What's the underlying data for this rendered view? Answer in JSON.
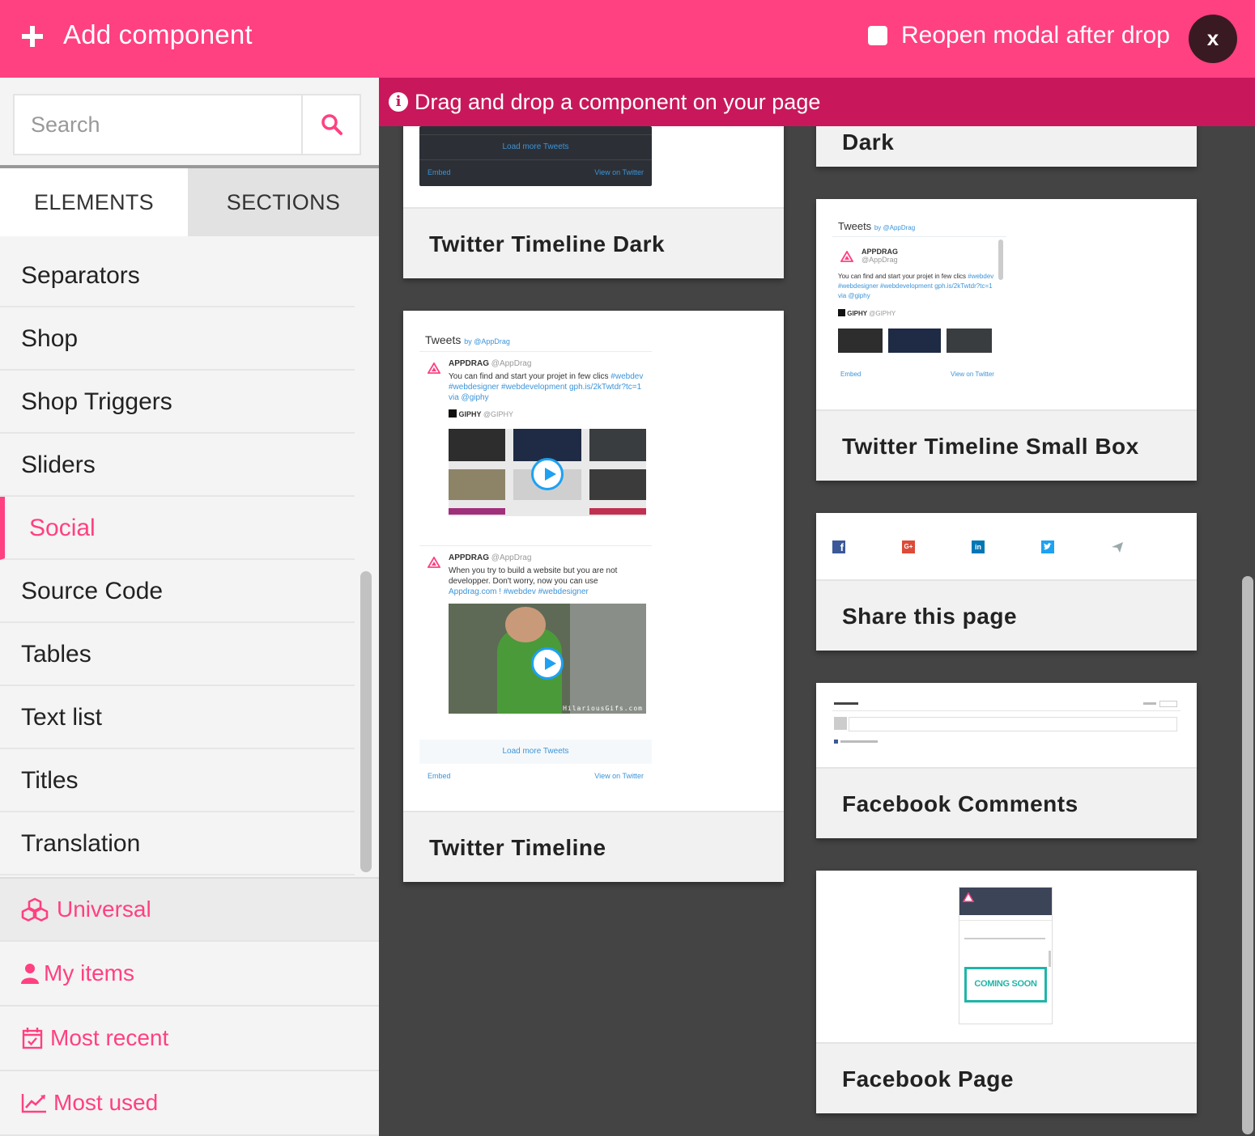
{
  "header": {
    "title": "Add component",
    "reopen_label": "Reopen modal after drop",
    "close_label": "x"
  },
  "search": {
    "placeholder": "Search"
  },
  "tabs": {
    "elements": "ELEMENTS",
    "sections": "SECTIONS"
  },
  "categories": [
    {
      "label": "Separators"
    },
    {
      "label": "Shop"
    },
    {
      "label": "Shop Triggers"
    },
    {
      "label": "Sliders"
    },
    {
      "label": "Social"
    },
    {
      "label": "Source Code"
    },
    {
      "label": "Tables"
    },
    {
      "label": "Text list"
    },
    {
      "label": "Titles"
    },
    {
      "label": "Translation"
    }
  ],
  "active_category": "Social",
  "bottom_nav": {
    "universal": "Universal",
    "my_items": "My items",
    "most_recent": "Most recent",
    "most_used": "Most used"
  },
  "banner": {
    "text": "Drag and drop a component on your page"
  },
  "cards": {
    "twitter_dark": "Twitter Timeline Dark",
    "dark_partial": "Dark",
    "twitter_timeline": "Twitter Timeline",
    "twitter_small": "Twitter Timeline Small Box",
    "share": "Share this page",
    "fb_comments": "Facebook Comments",
    "fb_page": "Facebook Page"
  },
  "preview": {
    "load_more": "Load more Tweets",
    "embed": "Embed",
    "view_on_twitter": "View on Twitter",
    "tweets": "Tweets",
    "by_handle": "by @AppDrag",
    "appdrag": "APPDRAG",
    "appdrag_handle": "@AppDrag",
    "tweet1": "You can find and start your projet in few clics",
    "tweet1_tags": "#webdev #webdesigner #webdevelopment gph.is/2kTwtdr?tc=1",
    "via": "via @giphy",
    "giphy": "GIPHY",
    "giphy_handle": "@GIPHY",
    "tweet2": "When you try to build a website but you are not developper. Don't worry, now you can use",
    "tweet2_tags": "Appdrag.com ! #webdev #webdesigner",
    "watermark": "HilariousGifs.com",
    "coming_soon": "COMING SOON"
  },
  "colors": {
    "accent": "#ff4081",
    "banner": "#c8185b",
    "close_bg": "#3a1a22"
  }
}
